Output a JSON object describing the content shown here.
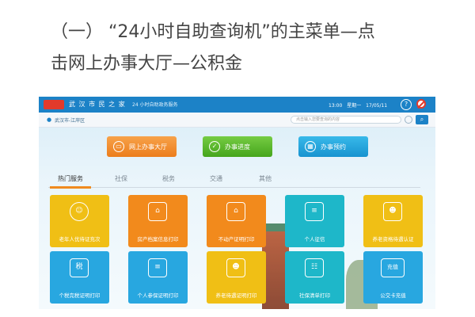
{
  "caption": {
    "line1": "（一）  “24小时自助查询机”的主菜单—点",
    "line2": "击网上办事大厅—公积金"
  },
  "kiosk": {
    "brand": "武 汉 市 民 之 家",
    "service": "24 小时自助政务服务",
    "time": "13:00",
    "weekday": "星期一",
    "date": "17/05/11",
    "location": "武汉市-江岸区",
    "search_placeholder": "点击输入您要查询的内容",
    "actions": [
      {
        "label": "网上办事大厅",
        "color": "#ec7d1c"
      },
      {
        "label": "办事进度",
        "color": "#45a51c"
      },
      {
        "label": "办事预约",
        "color": "#1793d0"
      }
    ],
    "tabs": [
      "热门服务",
      "社保",
      "税务",
      "交通",
      "其他"
    ],
    "tiles": [
      {
        "label": "老年人优待证充次",
        "icon": "elderly-icon"
      },
      {
        "label": "房产档案信息打印",
        "icon": "house-file-icon"
      },
      {
        "label": "不动产证明打印",
        "icon": "property-icon"
      },
      {
        "label": "个人征信",
        "icon": "credit-doc-icon"
      },
      {
        "label": "养老资格待遇认证",
        "icon": "pension-id-icon"
      },
      {
        "label": "个税完税证明打印",
        "icon": "tax-icon",
        "icon_text": "税"
      },
      {
        "label": "个人参保证明打印",
        "icon": "insurance-doc-icon"
      },
      {
        "label": "养老待遇证明打印",
        "icon": "pension-doc-icon"
      },
      {
        "label": "社保清单打印",
        "icon": "social-list-icon"
      },
      {
        "label": "公交卡充值",
        "icon": "bus-card-icon",
        "icon_text": "充值"
      }
    ]
  }
}
